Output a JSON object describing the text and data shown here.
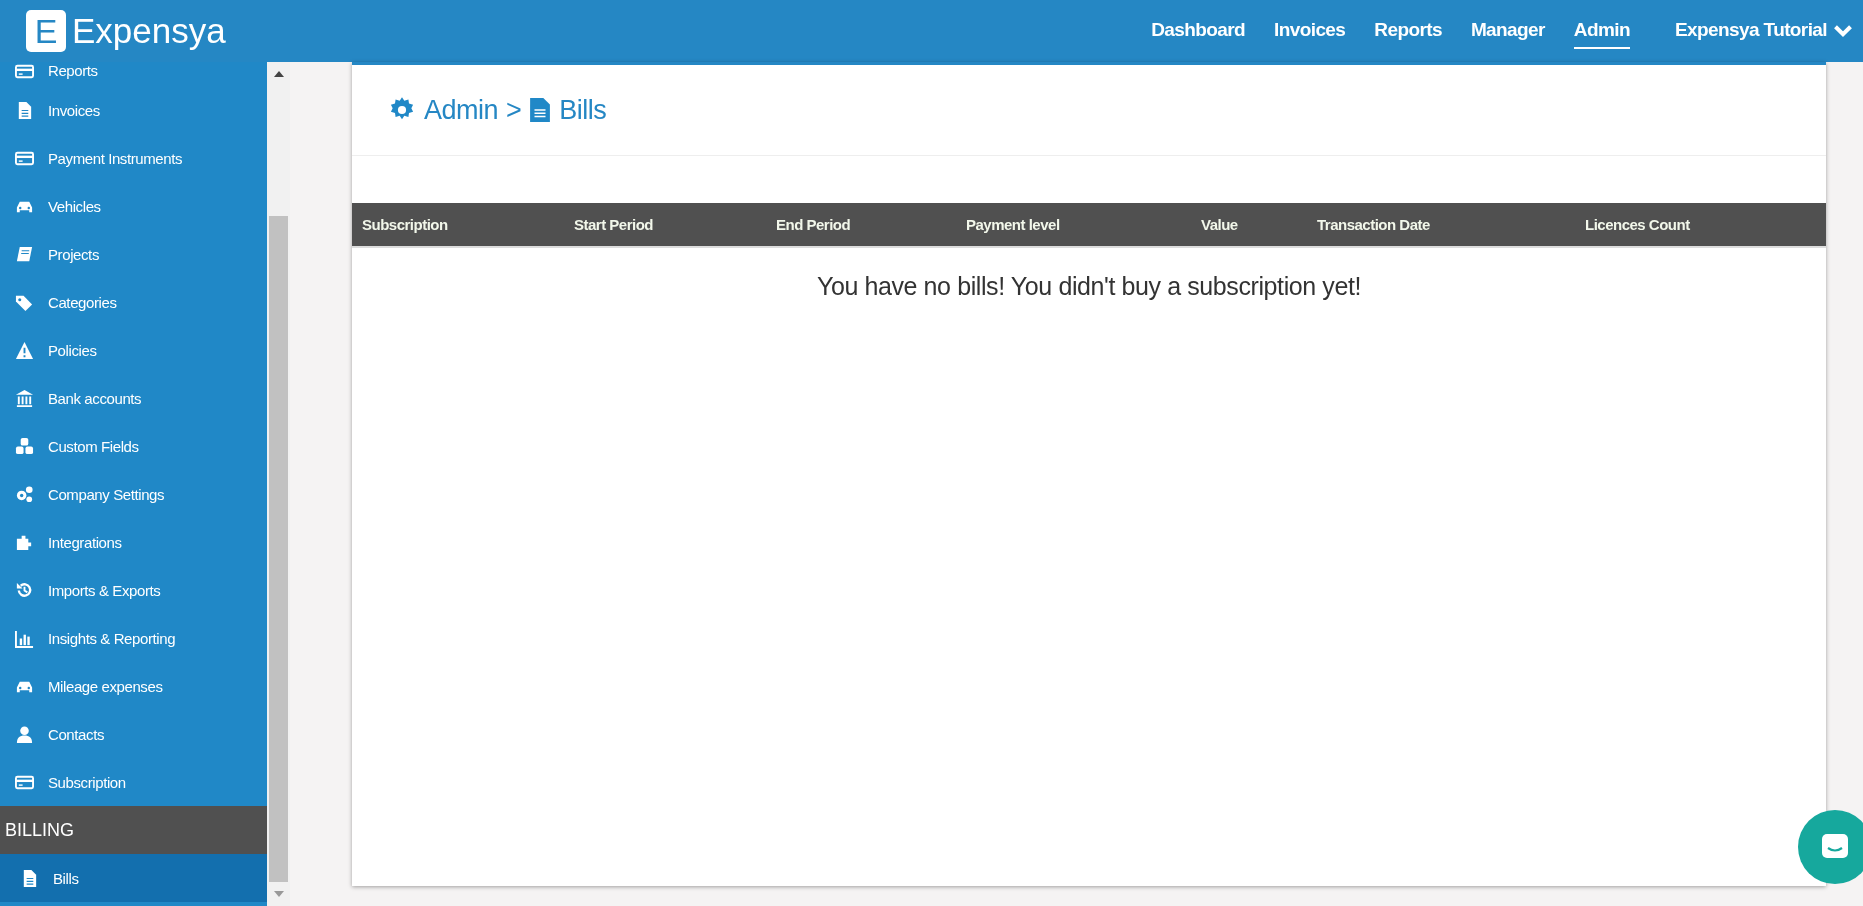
{
  "brand": {
    "letter": "E",
    "name": "Expensya"
  },
  "nav": [
    {
      "label": "Dashboard",
      "selected": false
    },
    {
      "label": "Invoices",
      "selected": false
    },
    {
      "label": "Reports",
      "selected": false
    },
    {
      "label": "Manager",
      "selected": false
    },
    {
      "label": "Admin",
      "selected": true
    }
  ],
  "user_menu": {
    "label": "Expensya Tutorial"
  },
  "sidebar": {
    "items": [
      {
        "label": "Reports",
        "selected": false
      },
      {
        "label": "Invoices",
        "selected": false
      },
      {
        "label": "Payment Instruments",
        "selected": false
      },
      {
        "label": "Vehicles",
        "selected": false
      },
      {
        "label": "Projects",
        "selected": false
      },
      {
        "label": "Categories",
        "selected": false
      },
      {
        "label": "Policies",
        "selected": false
      },
      {
        "label": "Bank accounts",
        "selected": false
      },
      {
        "label": "Custom Fields",
        "selected": false
      },
      {
        "label": "Company Settings",
        "selected": false
      },
      {
        "label": "Integrations",
        "selected": false
      },
      {
        "label": "Imports & Exports",
        "selected": false
      },
      {
        "label": "Insights & Reporting",
        "selected": false
      },
      {
        "label": "Mileage expenses",
        "selected": false
      },
      {
        "label": "Contacts",
        "selected": false
      },
      {
        "label": "Subscription",
        "selected": false
      }
    ],
    "section": {
      "title": "BILLING",
      "items": [
        {
          "label": "Bills",
          "selected": true
        }
      ]
    }
  },
  "breadcrumb": {
    "items": [
      "Admin",
      "Bills"
    ],
    "separator": ">"
  },
  "table": {
    "columns": [
      "Subscription",
      "Start Period",
      "End Period",
      "Payment level",
      "Value",
      "Transaction Date",
      "Licences Count"
    ],
    "empty_message": "You have no bills! You didn't buy a subscription yet!"
  }
}
